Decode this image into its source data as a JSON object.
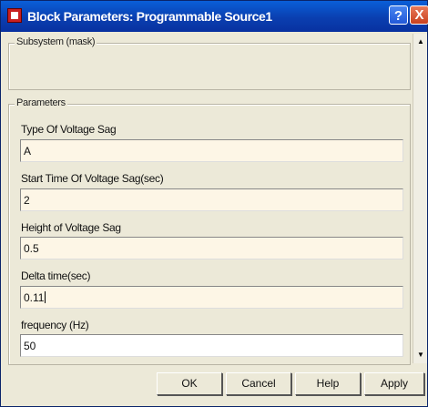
{
  "window": {
    "title": "Block Parameters: Programmable Source1",
    "help_label": "?",
    "close_label": "X"
  },
  "subsystem": {
    "legend": "Subsystem (mask)"
  },
  "parameters": {
    "legend": "Parameters",
    "fields": [
      {
        "label": "Type Of Voltage Sag",
        "value": "A"
      },
      {
        "label": "Start Time Of Voltage Sag(sec)",
        "value": "2"
      },
      {
        "label": "Height of Voltage Sag",
        "value": "0.5"
      },
      {
        "label": "Delta time(sec)",
        "value": "0.11"
      },
      {
        "label": "frequency (Hz)",
        "value": "50"
      }
    ]
  },
  "scrollbar": {
    "up_icon": "arrow-up-icon",
    "down_icon": "arrow-down-icon"
  },
  "buttons": {
    "ok": "OK",
    "cancel": "Cancel",
    "help": "Help",
    "apply": "Apply"
  }
}
